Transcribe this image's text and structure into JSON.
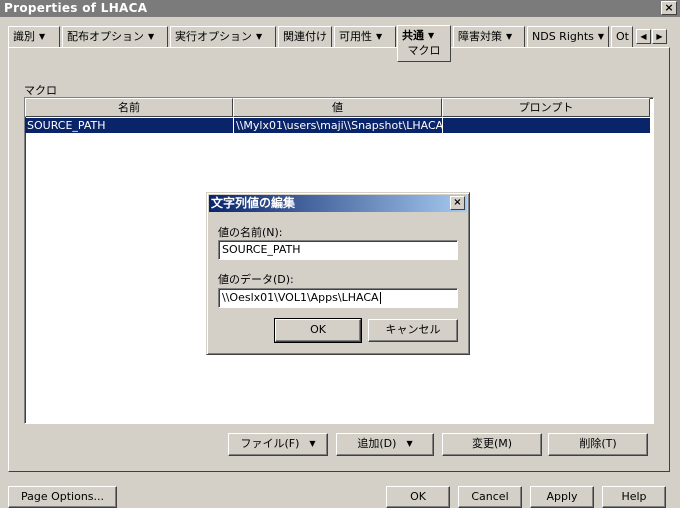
{
  "window": {
    "title": "Properties of LHACA",
    "close_label": "×"
  },
  "tabs": [
    {
      "label": "識別"
    },
    {
      "label": "配布オプション"
    },
    {
      "label": "実行オプション"
    },
    {
      "label": "関連付け"
    },
    {
      "label": "可用性"
    },
    {
      "label": "共通",
      "active": true,
      "sub_label": "マクロ"
    },
    {
      "label": "障害対策"
    },
    {
      "label": "NDS Rights"
    },
    {
      "label": "Ot"
    }
  ],
  "tab_scroll": {
    "left": "◀",
    "right": "▶"
  },
  "section": {
    "label": "マクロ"
  },
  "table": {
    "columns": [
      "名前",
      "値",
      "プロンプト"
    ],
    "rows": [
      {
        "name": "SOURCE_PATH",
        "value": "\\\\Mylx01\\users\\maji\\\\Snapshot\\LHACA",
        "prompt": ""
      }
    ]
  },
  "dialog": {
    "title": "文字列値の編集",
    "close_label": "×",
    "name_label": "値の名前(N):",
    "name_value": "SOURCE_PATH",
    "data_label": "値のデータ(D):",
    "data_value": "\\\\Oeslx01\\VOL1\\Apps\\LHACA",
    "ok_label": "OK",
    "cancel_label": "キャンセル"
  },
  "panel_buttons": {
    "file_label": "ファイル(F)",
    "add_label": "追加(D)",
    "change_label": "変更(M)",
    "delete_label": "削除(T)",
    "dropdown_arrow": "▼"
  },
  "footer": {
    "page_options_label": "Page Options...",
    "ok_label": "OK",
    "cancel_label": "Cancel",
    "apply_label": "Apply",
    "help_label": "Help"
  }
}
